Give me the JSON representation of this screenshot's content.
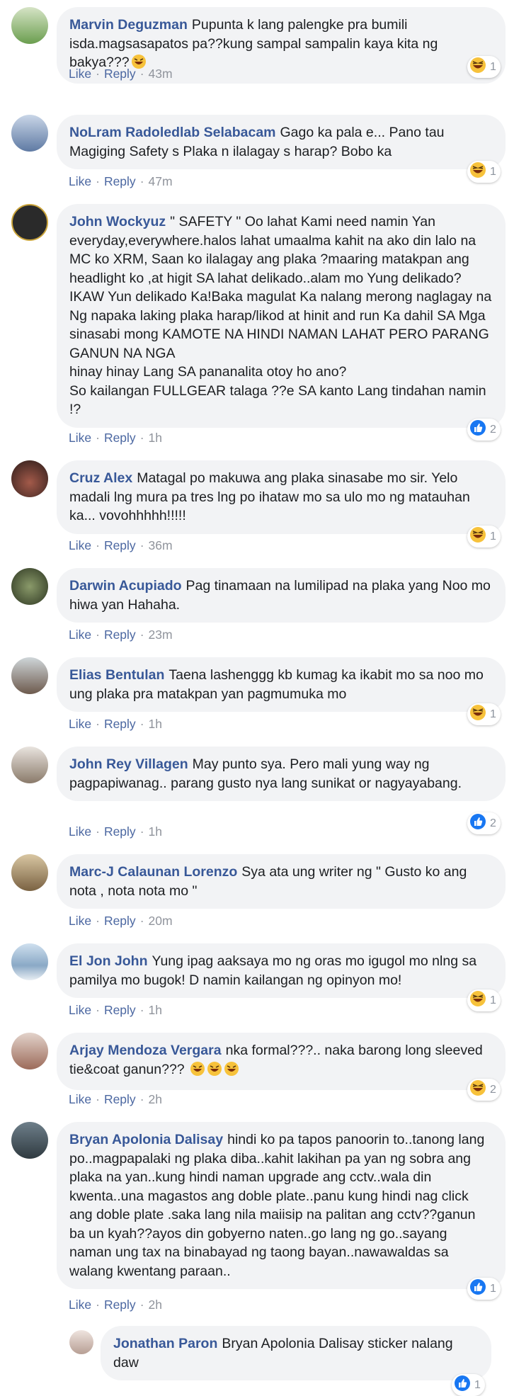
{
  "ui": {
    "like_label": "Like",
    "reply_label": "Reply"
  },
  "comments": [
    {
      "author": "Marvin Deguzman",
      "text": "Pupunta k lang palengke pra bumili isda.magsasapatos pa??kung sampal sampalin kaya kita ng bakya???",
      "time": "43m",
      "reaction_icon": "haha-icon",
      "reaction_count": "1",
      "avatar_color": "#6b9e4f"
    },
    {
      "author": "NoLram Radoledlab Selabacam",
      "text": "Gago ka pala e... Pano tau Magiging Safety s Plaka n ilalagay s harap? Bobo ka",
      "time": "47m",
      "reaction_icon": "haha-icon",
      "reaction_count": "1",
      "avatar_color": "#5f7aa3"
    },
    {
      "author": "John Wockyuz",
      "text": "\" SAFETY \" Oo lahat Kami need namin Yan everyday,everywhere.halos lahat umaalma kahit na ako din lalo na MC ko XRM, Saan ko ilalagay ang plaka ?maaring matakpan ang headlight ko ,at higit SA lahat delikado..alam mo Yung delikado? IKAW Yun delikado Ka!Baka magulat Ka nalang merong naglagay na Ng napaka laking plaka harap/likod at hinit and run Ka dahil SA Mga sinasabi mong KAMOTE NA HINDI NAMAN LAHAT PERO PARANG GANUN NA NGA \nhinay hinay Lang SA pananalita otoy ho ano?\nSo kailangan FULLGEAR talaga ??e SA kanto Lang tindahan namin !?",
      "time": "1h",
      "reaction_icon": "like-icon",
      "reaction_count": "2",
      "avatar_color": "#2a2a2a"
    },
    {
      "author": "Cruz Alex",
      "text": "Matagal po makuwa ang plaka sinasabe mo sir. Yelo madali lng mura pa tres lng po ihataw mo sa ulo mo ng matauhan ka... vovohhhhh!!!!!",
      "time": "36m",
      "reaction_icon": "haha-icon",
      "reaction_count": "1",
      "avatar_color": "#3b2420"
    },
    {
      "author": "Darwin Acupiado",
      "text": "Pag tinamaan na lumilipad na plaka yang Noo mo hiwa yan Hahaha.",
      "time": "23m",
      "reaction_icon": "",
      "reaction_count": "",
      "avatar_color": "#4c5a3a"
    },
    {
      "author": "Elias Bentulan",
      "text": "Taena lashenggg kb kumag ka ikabit mo sa noo mo ung plaka pra matakpan yan pagmumuka mo",
      "time": "1h",
      "reaction_icon": "haha-icon",
      "reaction_count": "1",
      "avatar_color": "#7d8a8f"
    },
    {
      "author": "John Rey Villagen",
      "text": "May punto sya. Pero mali yung way ng pagpapiwanag.. parang gusto nya lang sunikat or nagyayabang.",
      "time": "1h",
      "reaction_icon": "like-icon",
      "reaction_count": "2",
      "avatar_color": "#8a7a6a"
    },
    {
      "author": "Marc-J Calaunan Lorenzo",
      "text": "Sya ata ung writer ng \" Gusto ko ang nota , nota nota mo \"",
      "time": "20m",
      "reaction_icon": "",
      "reaction_count": "",
      "avatar_color": "#a38b63"
    },
    {
      "author": "El Jon John",
      "text": "Yung ipag aaksaya mo ng oras mo igugol mo nlng sa pamilya mo bugok! D namin kailangan ng opinyon mo!",
      "time": "1h",
      "reaction_icon": "haha-icon",
      "reaction_count": "1",
      "avatar_color": "#8aa9c6"
    },
    {
      "author": "Arjay Mendoza Vergara",
      "text": "nka formal???.. naka barong long sleeved tie&coat ganun???",
      "time": "2h",
      "reaction_icon": "haha-icon",
      "reaction_count": "2",
      "avatar_color": "#9c6b5a"
    },
    {
      "author": "Bryan Apolonia Dalisay",
      "text": "hindi ko pa tapos panoorin to..tanong lang po..magpapalaki ng plaka diba..kahit lakihan pa yan ng sobra ang plaka na yan..kung hindi naman upgrade ang cctv..wala din kwenta..una magastos ang doble plate..panu kung hindi nag click ang doble plate .saka lang nila maiisip na palitan ang cctv??ganun ba un kyah??ayos din gobyerno naten..go lang ng go..sayang naman ung tax na binabayad ng taong bayan..nawawaldas sa walang kwentang paraan..",
      "time": "2h",
      "reaction_icon": "like-icon",
      "reaction_count": "1",
      "avatar_color": "#3f4a52"
    },
    {
      "author": "Jonathan Paron",
      "text": "Bryan Apolonia Dalisay sticker nalang daw",
      "time": "",
      "reaction_icon": "like-icon",
      "reaction_count": "1",
      "avatar_color": "#b79f94"
    }
  ]
}
